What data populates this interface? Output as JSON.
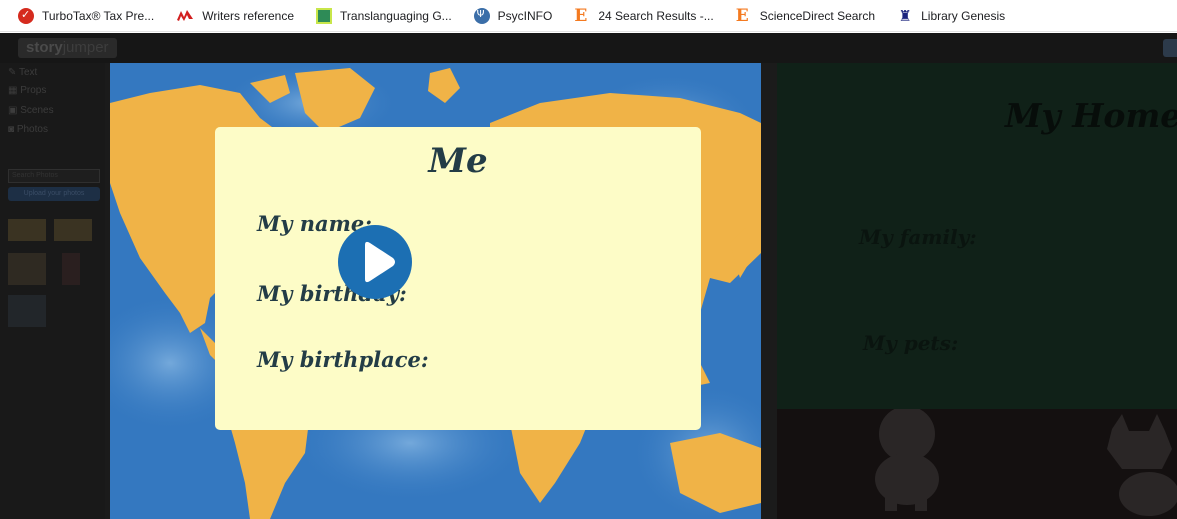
{
  "bookmarks": [
    {
      "label": "TurboTax® Tax Pre...",
      "icon": "turbotax-icon"
    },
    {
      "label": "Writers reference",
      "icon": "writers-reference-icon"
    },
    {
      "label": "Translanguaging G...",
      "icon": "translanguaging-icon"
    },
    {
      "label": "PsycINFO",
      "icon": "psycinfo-icon"
    },
    {
      "label": "24 Search Results -...",
      "icon": "elsevier-icon"
    },
    {
      "label": "ScienceDirect Search",
      "icon": "elsevier-icon"
    },
    {
      "label": "Library Genesis",
      "icon": "library-genesis-icon"
    }
  ],
  "app": {
    "logo_a": "story",
    "logo_b": "jumper",
    "sidebar": {
      "items": [
        "Text",
        "Props",
        "Scenes",
        "Photos"
      ],
      "search_placeholder": "Search Photos",
      "upload_label": "Upload your photos"
    }
  },
  "left_page": {
    "title": "Me",
    "lines": [
      "My name:",
      "My birthday:",
      "My birthplace:"
    ]
  },
  "right_page": {
    "title": "My Home",
    "lines": [
      "My family:",
      "My pets:"
    ]
  },
  "colors": {
    "card_bg": "#fdfcc7",
    "card_text": "#233c46",
    "play_button": "#1c6fb3",
    "ocean": "#3478c0",
    "land": "#f0b347"
  }
}
